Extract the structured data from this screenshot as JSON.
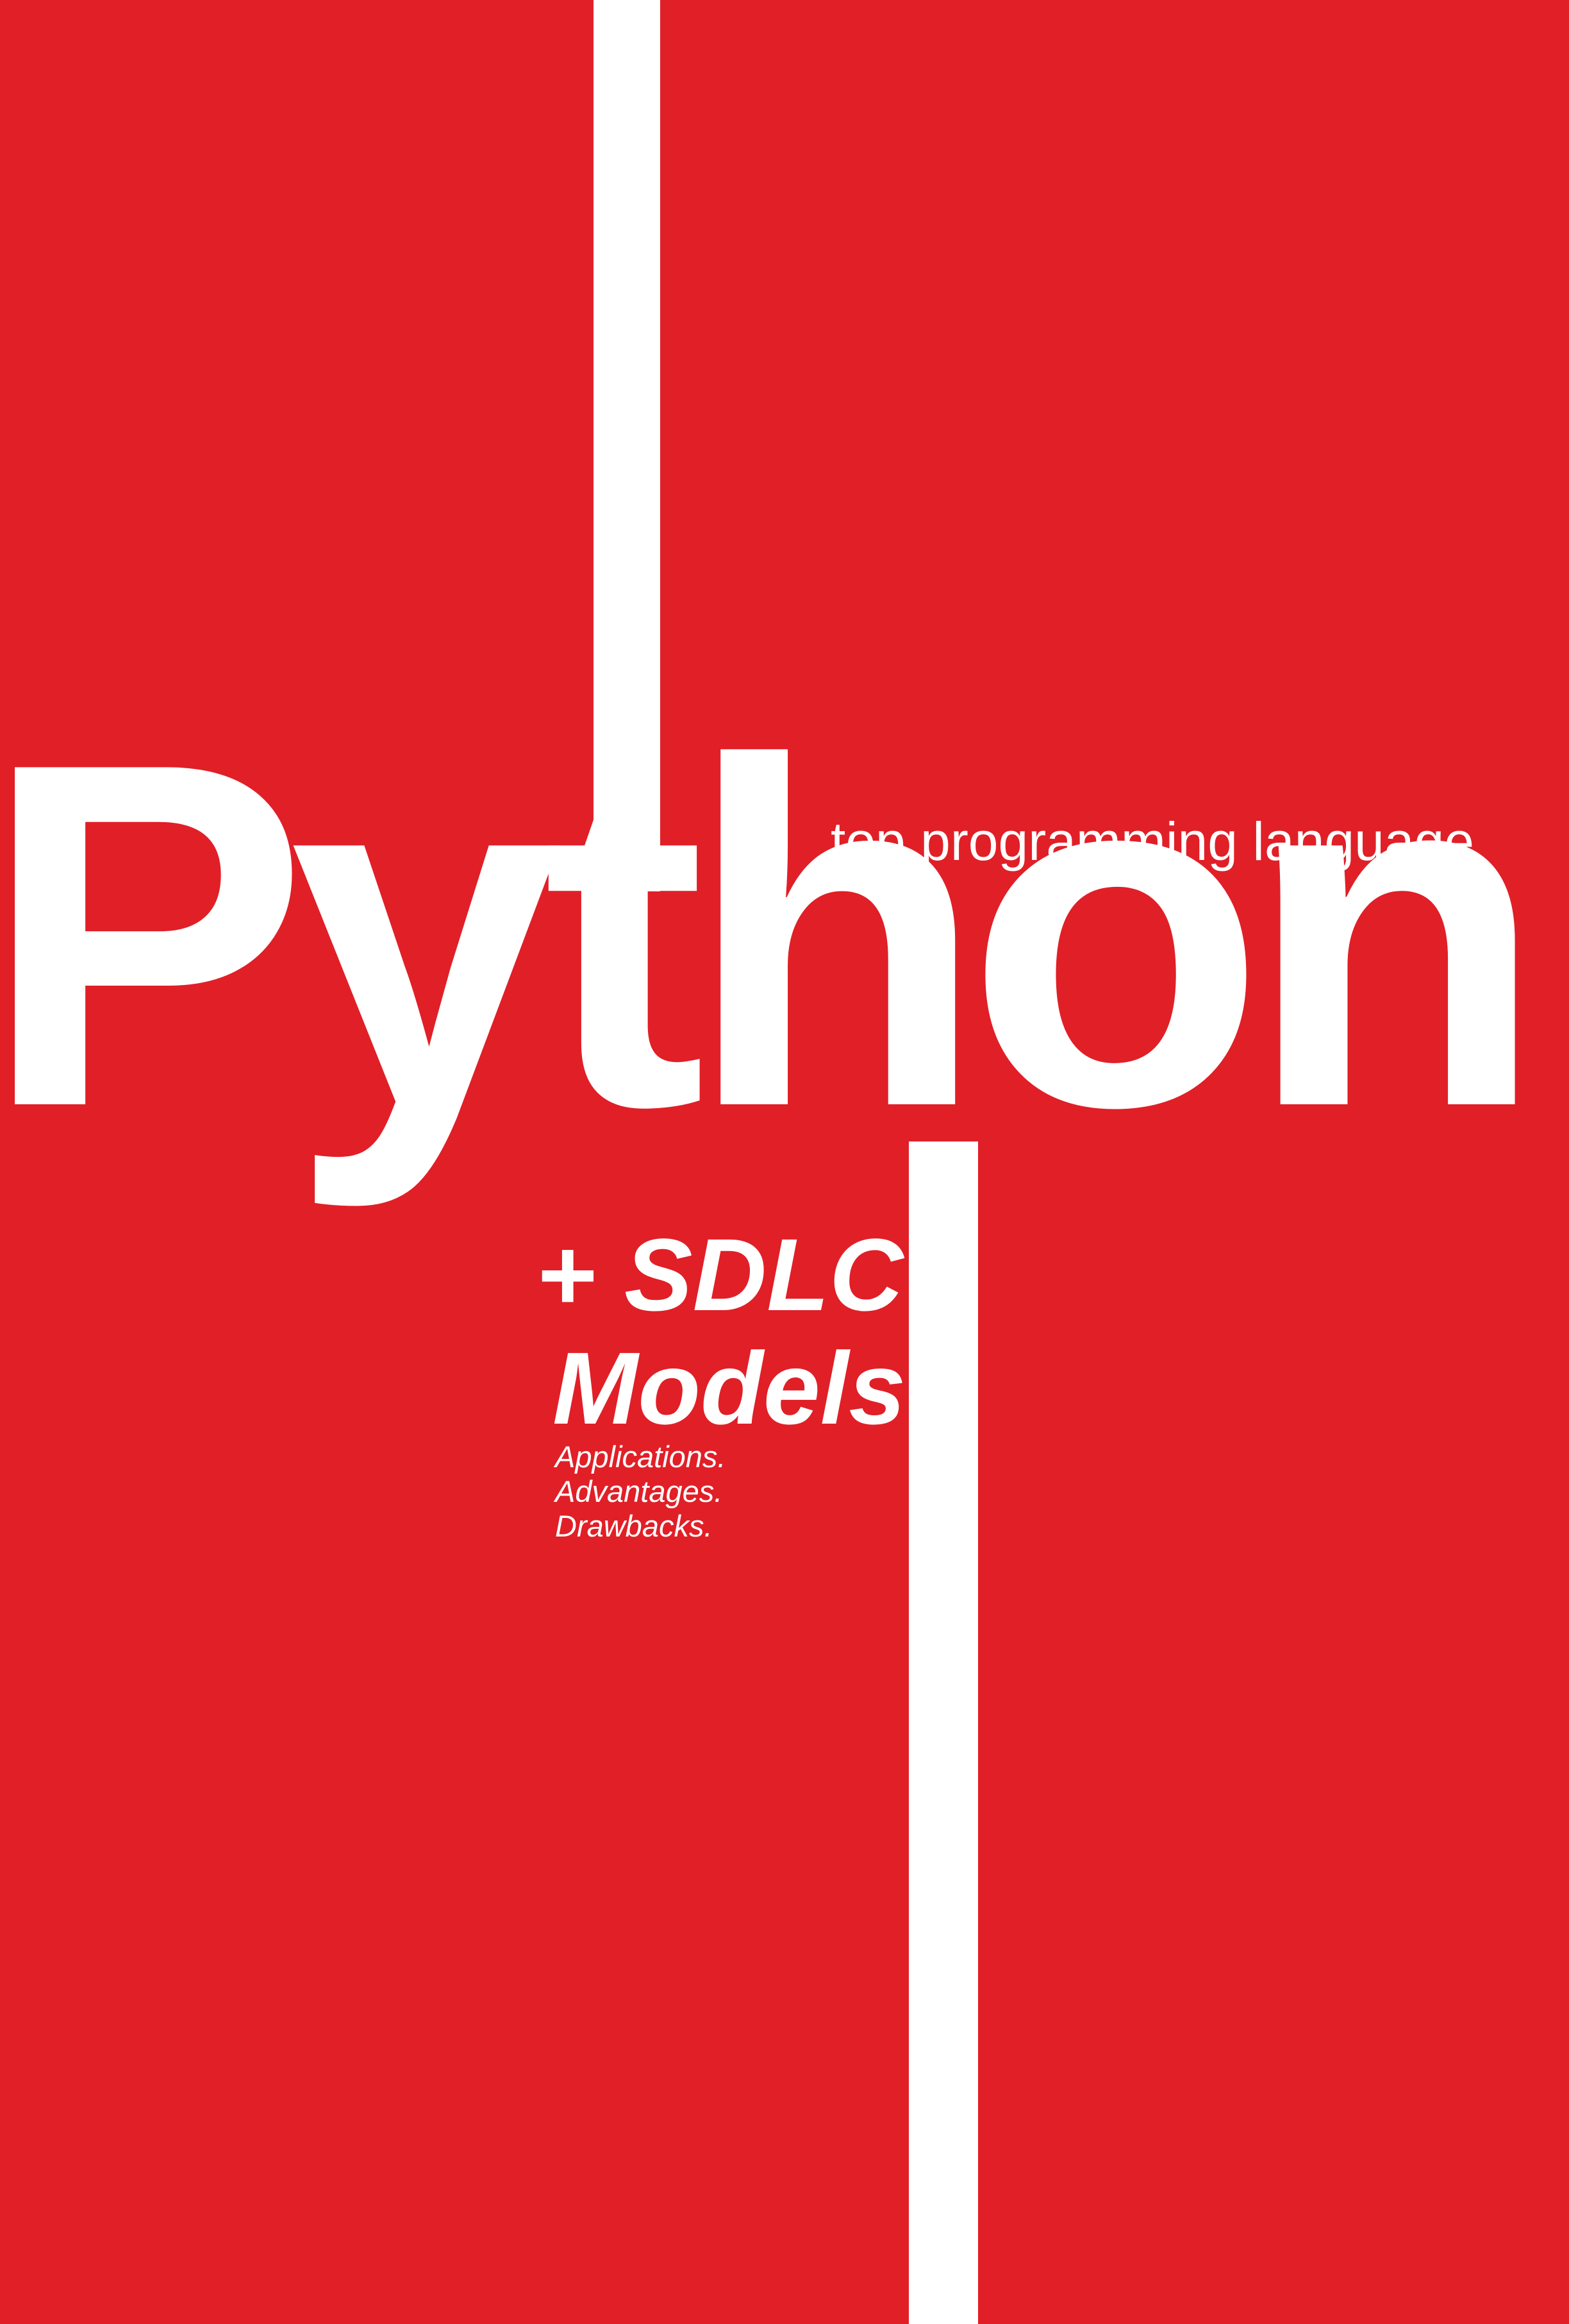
{
  "cover": {
    "background_color": "#e11f27",
    "text_color": "#ffffff",
    "title": "Python",
    "tagline": "top programming language",
    "subtitle_line_1": "+ SDLC",
    "subtitle_line_2": "Models",
    "topics": [
      "Applications.",
      "Advantages.",
      "Drawbacks."
    ]
  }
}
